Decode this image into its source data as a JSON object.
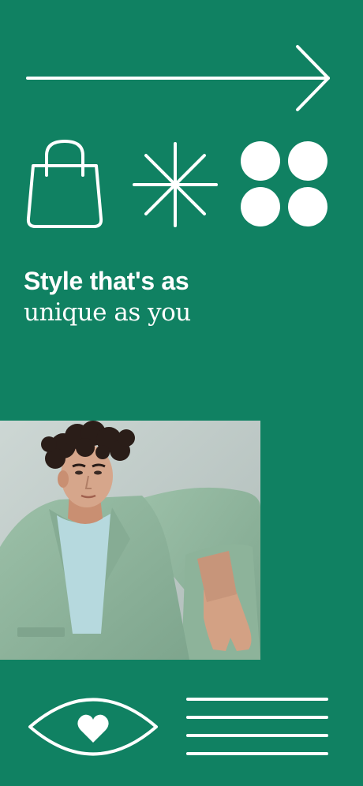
{
  "screen": {
    "background_color": "#108162",
    "foreground_color": "#ffffff"
  },
  "icons": {
    "top_row": [
      "arrow-right-icon"
    ],
    "middle_row": [
      "shopping-bag-icon",
      "asterisk-star-icon",
      "grid-dots-icon"
    ],
    "bottom_row": [
      "eye-heart-icon",
      "menu-lines-icon"
    ]
  },
  "headline": {
    "line1": "Style that's as",
    "line2": "unique as you"
  },
  "photo": {
    "subject": "model-in-sage-green-suit",
    "colors": {
      "backdrop": "#c4cfcc",
      "suit": "#8fb59d",
      "tshirt": "#b5d8de",
      "skin": "#d3a184",
      "hair": "#2a1d18"
    }
  }
}
